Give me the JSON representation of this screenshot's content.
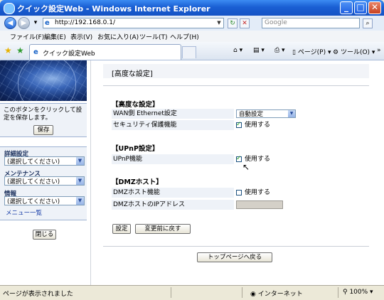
{
  "window": {
    "title": "クイック設定Web - Windows Internet Explorer"
  },
  "addressbar": {
    "url": "http://192.168.0.1/",
    "search_placeholder": "Google"
  },
  "menubar": {
    "items": [
      "ファイル(F)",
      "編集(E)",
      "表示(V)",
      "お気に入り(A)",
      "ツール(T)",
      "ヘルプ(H)"
    ]
  },
  "favbar": {
    "tab_title": "クイック設定Web",
    "page_label": "ページ(P)",
    "tools_label": "ツール(O)"
  },
  "sidebar": {
    "note": "このボタンをクリックして設定を保存します。",
    "save_button": "保存",
    "advanced_label": "詳細設定",
    "advanced_select": "(選択してください)",
    "maintenance_label": "メンテナンス",
    "maintenance_select": "(選択してください)",
    "info_label": "情報",
    "info_select": "(選択してください)",
    "menu_list_link": "メニュー一覧",
    "close_button": "閉じる"
  },
  "main": {
    "page_title": "[高度な設定]",
    "sections": {
      "advanced": {
        "title": "【高度な設定】",
        "wan_label": "WAN側 Ethernet設定",
        "wan_value": "自動設定",
        "security_label": "セキュリティ保護機能",
        "security_value": "使用する",
        "security_checked": true
      },
      "upnp": {
        "title": "【UPnP設定】",
        "upnp_label": "UPnP機能",
        "upnp_value": "使用する",
        "upnp_checked": true
      },
      "dmz": {
        "title": "【DMZホスト】",
        "dmz_label": "DMZホスト機能",
        "dmz_value": "使用する",
        "dmz_checked": false,
        "dmz_ip_label": "DMZホストのIPアドレス",
        "dmz_ip_value": ""
      }
    },
    "set_button": "設定",
    "revert_button": "変更前に戻す",
    "top_button": "トップページへ戻る"
  },
  "statusbar": {
    "status": "ページが表示されました",
    "zone": "インターネット",
    "zoom": "100%"
  }
}
